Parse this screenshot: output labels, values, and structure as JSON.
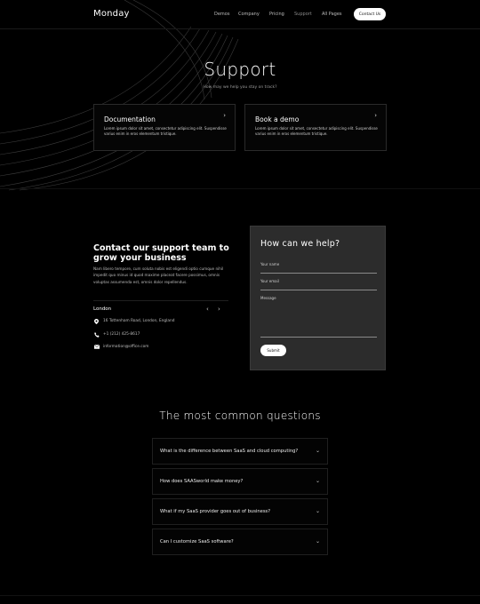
{
  "header": {
    "logo": "Monday",
    "nav": [
      "Demos",
      "Company",
      "Pricing",
      "Support",
      "All Pages"
    ],
    "active_nav": "Support",
    "cta": "Contact Us"
  },
  "hero": {
    "title": "Support",
    "subtitle": "How may we help you stay on track?",
    "cards": [
      {
        "title": "Documentation",
        "text": "Lorem ipsum dolor sit amet, consectetur adipiscing elit. Suspendisse varius enim in eros elementum tristique.",
        "icon": "chevron-right-icon"
      },
      {
        "title": "Book a demo",
        "text": "Lorem ipsum dolor sit amet, consectetur adipiscing elit. Suspendisse varius enim in eros elementum tristique.",
        "icon": "chevron-right-icon"
      }
    ]
  },
  "contact": {
    "title": "Contact our support team to grow your business",
    "text": "Nam libero tempore, cum soluta nobis est eligendi optio cumque nihil impedit quo minus id quod maxime placeat facere possimus, omnis voluptas assumenda est, omnis dolor repellendus.",
    "location": {
      "name": "London",
      "address": "16 Tottenham Road, London, England",
      "phone": "+1 (212) 425-8617",
      "email": "information@office.com"
    }
  },
  "form": {
    "title": "How can we help?",
    "name_label": "Your name",
    "email_label": "Your email",
    "message_label": "Message",
    "submit": "Submit"
  },
  "faq": {
    "title": "The most common questions",
    "items": [
      "What is the difference between SaaS and cloud computing?",
      "How does SAASworld make money?",
      "What if my SaaS provider goes out of business?",
      "Can I customize SaaS software?"
    ]
  },
  "colors": {
    "background": "#000000",
    "form_panel": "#2c2c2c",
    "button": "#ffffff"
  }
}
